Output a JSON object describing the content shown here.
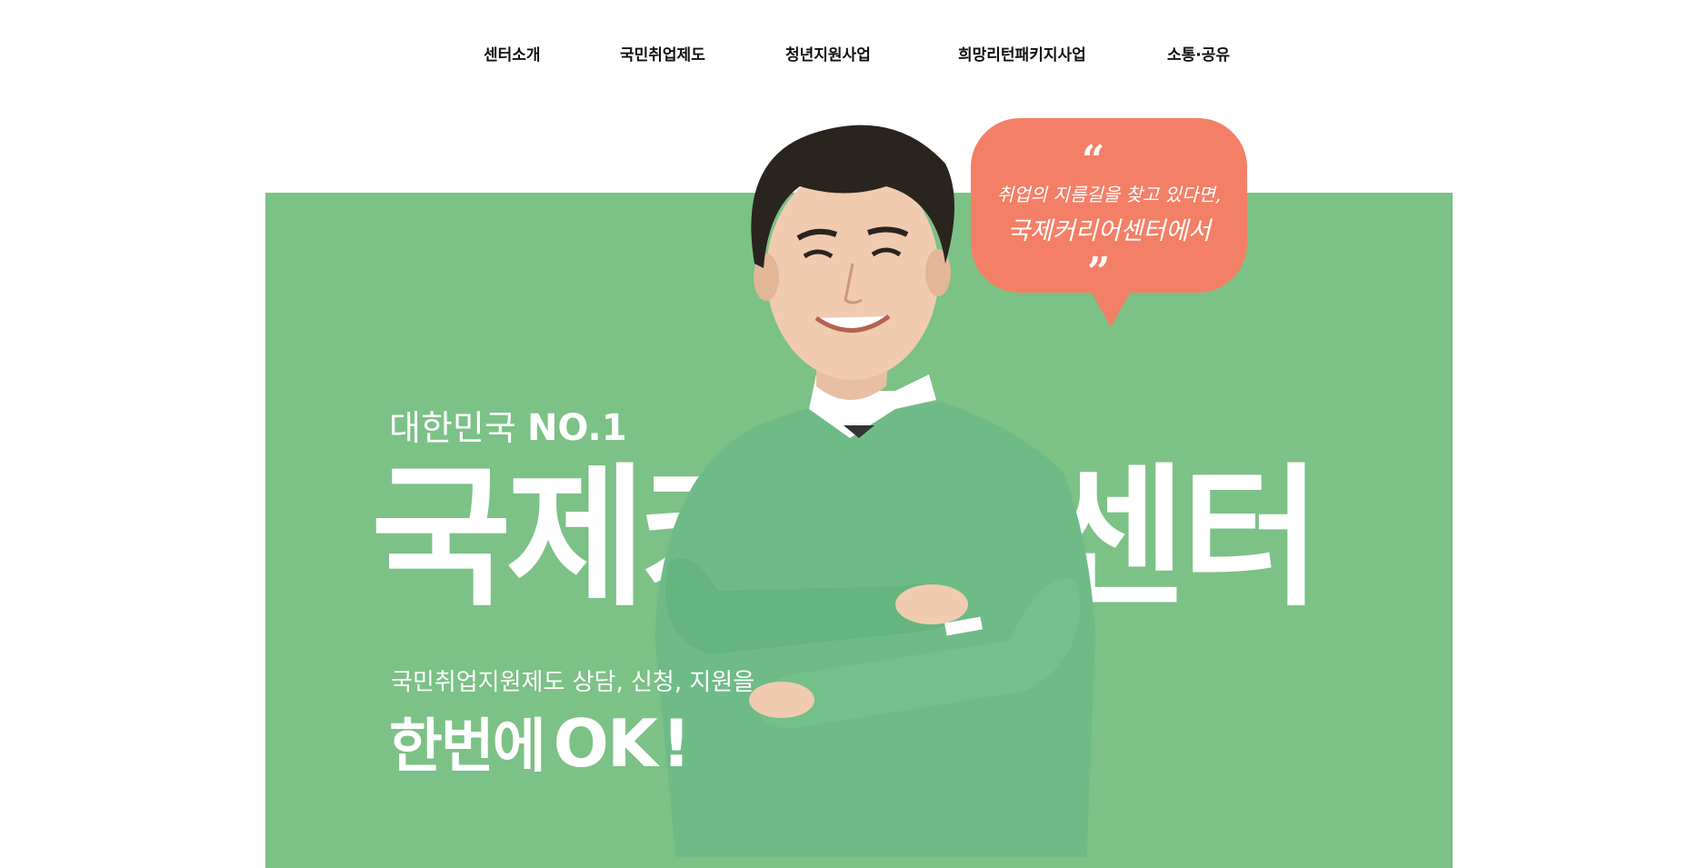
{
  "nav": {
    "items": [
      {
        "label": "센터소개"
      },
      {
        "label": "국민취업제도"
      },
      {
        "label": "청년지원사업"
      },
      {
        "label": "희망리턴패키지사업"
      },
      {
        "label": "소통·공유"
      }
    ]
  },
  "hero": {
    "bubble": {
      "open_quote": "“",
      "line1": "취업의 지름길을 찾고 있다면,",
      "line2": "국제커리어센터에서",
      "close_quote": "”"
    },
    "eyebrow_light": "대한민국",
    "eyebrow_bold": "NO.1",
    "title": "국제커리어센터",
    "subtitle": "국민취업지원제도 상담, 신청, 지원을",
    "tagline_ko": "한번에",
    "tagline_ok": "OK",
    "tagline_excl": "!"
  },
  "colors": {
    "hero_bg": "#7cc186",
    "bubble": "#f47f67",
    "sweater": "#6fbb87"
  }
}
